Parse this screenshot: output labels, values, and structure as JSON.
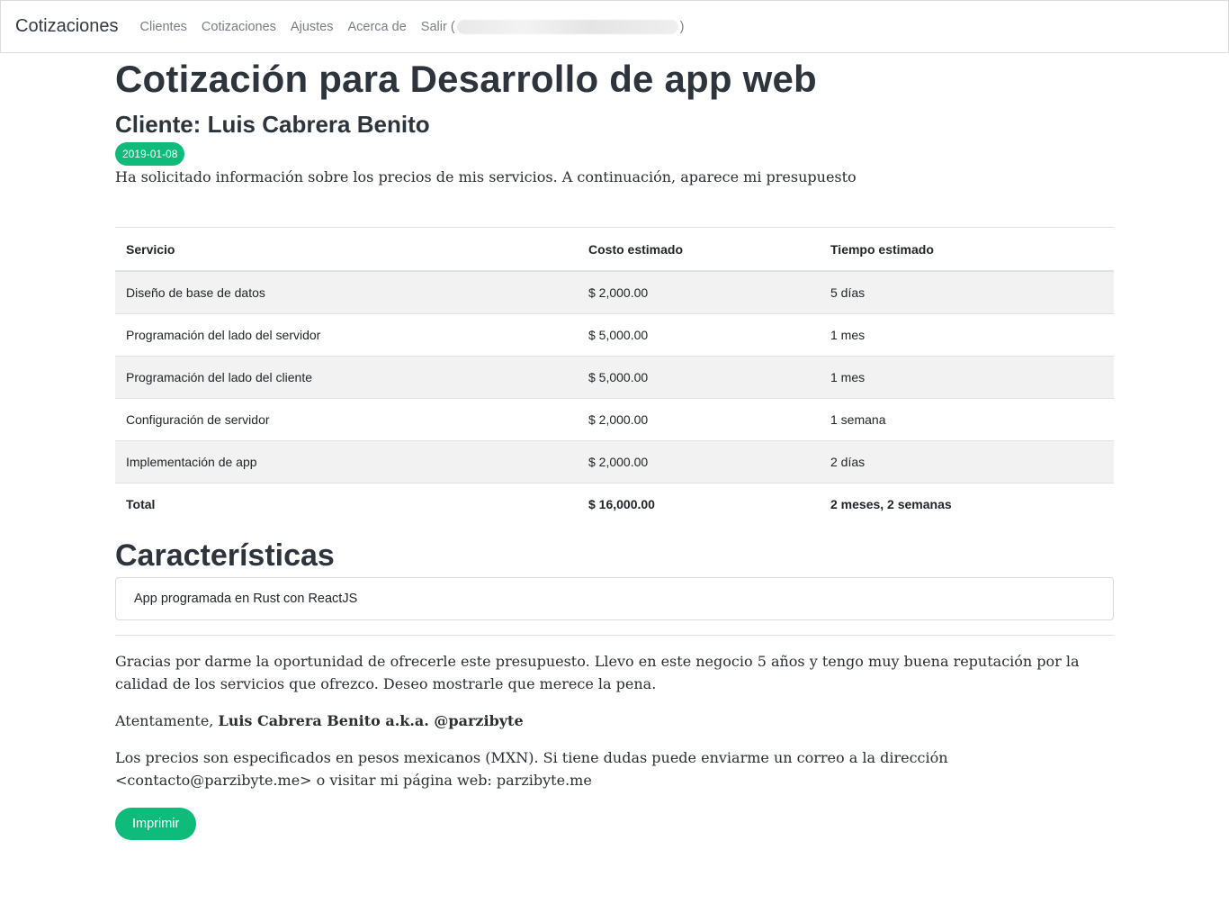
{
  "navbar": {
    "brand": "Cotizaciones",
    "links": [
      "Clientes",
      "Cotizaciones",
      "Ajustes",
      "Acerca de"
    ],
    "logout_prefix": "Salir (",
    "logout_suffix": ")"
  },
  "header": {
    "title": "Cotización para Desarrollo de app web",
    "client": "Cliente: Luis Cabrera Benito",
    "date": "2019-01-08",
    "intro": "Ha solicitado información sobre los precios de mis servicios. A continuación, aparece mi presupuesto"
  },
  "table": {
    "headers": [
      "Servicio",
      "Costo estimado",
      "Tiempo estimado"
    ],
    "rows": [
      [
        "Diseño de base de datos",
        "$ 2,000.00",
        "5 días"
      ],
      [
        "Programación del lado del servidor",
        "$ 5,000.00",
        "1 mes"
      ],
      [
        "Programación del lado del cliente",
        "$ 5,000.00",
        "1 mes"
      ],
      [
        "Configuración de servidor",
        "$ 2,000.00",
        "1 semana"
      ],
      [
        "Implementación de app",
        "$ 2,000.00",
        "2 días"
      ]
    ],
    "total": [
      "Total",
      "$ 16,000.00",
      "2 meses, 2 semanas"
    ]
  },
  "features": {
    "title": "Características",
    "items": [
      "App programada en Rust con ReactJS"
    ]
  },
  "footer": {
    "thanks": "Gracias por darme la oportunidad de ofrecerle este presupuesto. Llevo en este negocio 5 años y tengo muy buena reputación por la calidad de los servicios que ofrezco. Deseo mostrarle que merece la pena.",
    "regards_prefix": "Atentamente, ",
    "regards_name": "Luis Cabrera Benito a.k.a. @parzibyte",
    "note": "Los precios son especificados en pesos mexicanos (MXN). Si tiene dudas puede enviarme un correo a la dirección <contacto@parzibyte.me> o visitar mi página web: parzibyte.me",
    "print_label": "Imprimir"
  },
  "colors": {
    "accent": "#0fbb7a",
    "heading": "#2d343b",
    "nav_text": "#7a7f85",
    "stripe": "#f2f2f2"
  }
}
